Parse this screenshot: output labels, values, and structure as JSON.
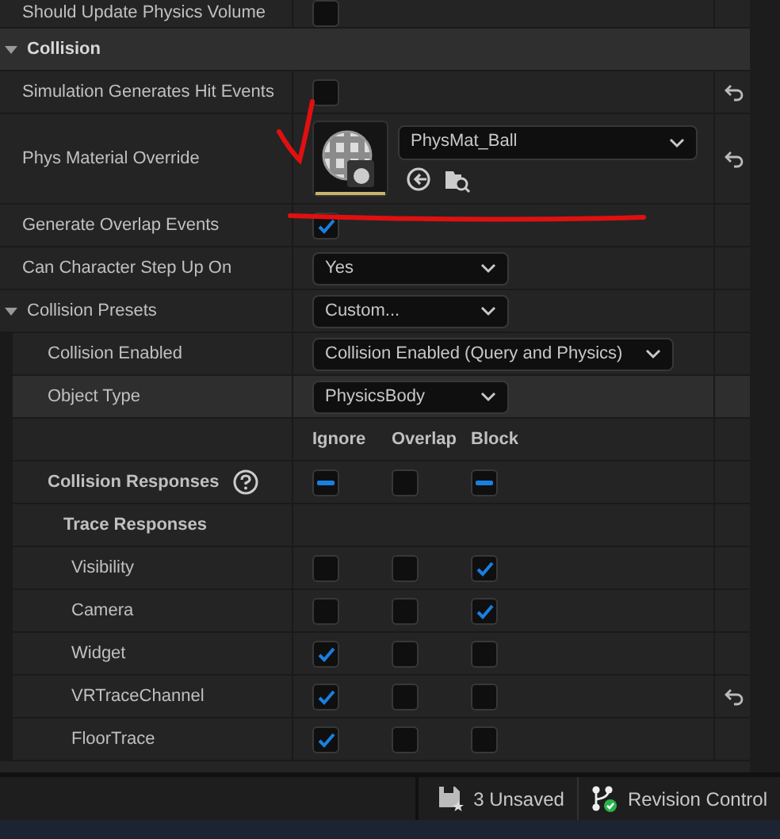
{
  "details": {
    "rows": [
      {
        "kind": "checkbox",
        "label": "Should Update Physics Volume",
        "checked": false,
        "resettable": false
      },
      {
        "kind": "section",
        "label": "Collision",
        "expanded": true,
        "children": [
          {
            "kind": "checkbox",
            "label": "Simulation Generates Hit Events",
            "checked": false,
            "resettable": true
          },
          {
            "kind": "asset",
            "label": "Phys Material Override",
            "value": "PhysMat_Ball",
            "resettable": true
          },
          {
            "kind": "checkbox",
            "label": "Generate Overlap Events",
            "checked": true,
            "resettable": false
          },
          {
            "kind": "dropdown",
            "label": "Can Character Step Up On",
            "value": "Yes",
            "resettable": false
          },
          {
            "kind": "dropdown",
            "label": "Collision Presets",
            "value": "Custom...",
            "expanded": true,
            "resettable": false,
            "children": [
              {
                "kind": "dropdown",
                "label": "Collision Enabled",
                "value": "Collision Enabled (Query and Physics)",
                "resettable": false
              },
              {
                "kind": "dropdown",
                "label": "Object Type",
                "value": "PhysicsBody",
                "highlighted": true,
                "resettable": false
              },
              {
                "kind": "response_header",
                "columns": [
                  "Ignore",
                  "Overlap",
                  "Block"
                ]
              },
              {
                "kind": "responses",
                "label": "Collision Responses",
                "help": true,
                "resettable": false,
                "checks": [
                  {
                    "mixed": true
                  },
                  {
                    "mixed": false
                  },
                  {
                    "mixed": true
                  }
                ],
                "children": [
                  {
                    "kind": "group",
                    "label": "Trace Responses",
                    "children": [
                      {
                        "kind": "responses",
                        "label": "Visibility",
                        "resettable": false,
                        "checks": [
                          {
                            "checked": false
                          },
                          {
                            "checked": false
                          },
                          {
                            "checked": true
                          }
                        ]
                      },
                      {
                        "kind": "responses",
                        "label": "Camera",
                        "resettable": false,
                        "checks": [
                          {
                            "checked": false
                          },
                          {
                            "checked": false
                          },
                          {
                            "checked": true
                          }
                        ]
                      },
                      {
                        "kind": "responses",
                        "label": "Widget",
                        "resettable": false,
                        "checks": [
                          {
                            "checked": true
                          },
                          {
                            "checked": false
                          },
                          {
                            "checked": false
                          }
                        ]
                      },
                      {
                        "kind": "responses",
                        "label": "VRTraceChannel",
                        "resettable": true,
                        "checks": [
                          {
                            "checked": true
                          },
                          {
                            "checked": false
                          },
                          {
                            "checked": false
                          }
                        ]
                      },
                      {
                        "kind": "responses",
                        "label": "FloorTrace",
                        "resettable": false,
                        "checks": [
                          {
                            "checked": true
                          },
                          {
                            "checked": false
                          },
                          {
                            "checked": false
                          }
                        ]
                      }
                    ]
                  }
                ]
              }
            ]
          }
        ]
      }
    ]
  },
  "annotations": {
    "checkmark": true,
    "underline": true
  },
  "status_bar": {
    "unsaved": "3 Unsaved",
    "revision_control": "Revision Control"
  }
}
